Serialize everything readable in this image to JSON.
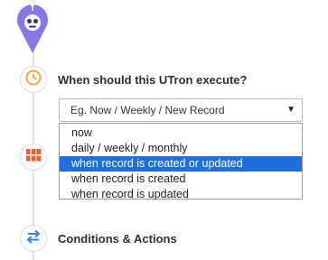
{
  "steps": [
    {
      "icon": "clock-icon",
      "title": "When should this UTron execute?",
      "color": "#f0a83c"
    },
    {
      "icon": "grid-icon",
      "title": "",
      "color": "#ef5b2b"
    },
    {
      "icon": "swap-arrows-icon",
      "title": "Conditions & Actions",
      "color": "#3b7fe0"
    }
  ],
  "trigger_select": {
    "placeholder": "Eg. Now / Weekly / New Record",
    "options": [
      "now",
      "daily / weekly / monthly",
      "when record is created or updated",
      "when record is created",
      "when record is updated"
    ],
    "highlighted_index": 2
  },
  "colors": {
    "marker": "#8b76e6",
    "highlight": "#1e6fd9",
    "timeline": "#e3e3e3"
  }
}
